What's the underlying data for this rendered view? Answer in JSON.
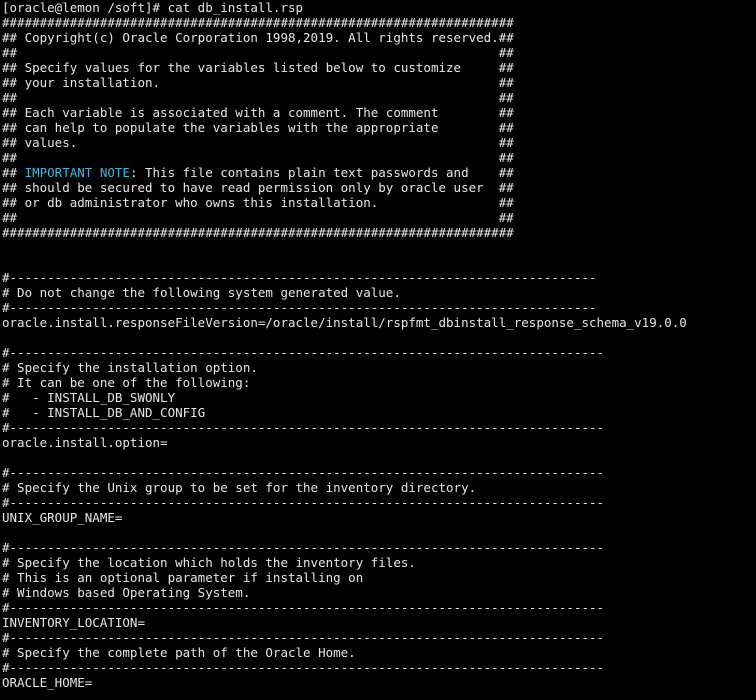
{
  "colors": {
    "background": "#000000",
    "text": "#e6e6e6",
    "highlight": "#3fb8d9"
  },
  "terminal": {
    "lines": [
      "[oracle@lemon /soft]# cat db_install.rsp",
      "####################################################################",
      "## Copyright(c) Oracle Corporation 1998,2019. All rights reserved.##",
      "##                                                                ##",
      "## Specify values for the variables listed below to customize     ##",
      "## your installation.                                             ##",
      "##                                                                ##",
      "## Each variable is associated with a comment. The comment        ##",
      "## can help to populate the variables with the appropriate        ##",
      "## values.                                                        ##",
      "##                                                                ##",
      "## IMPORTANT NOTE: This file contains plain text passwords and    ##",
      "## should be secured to have read permission only by oracle user  ##",
      "## or db administrator who owns this installation.                ##",
      "##                                                                ##",
      "####################################################################",
      "",
      "",
      "#------------------------------------------------------------------------------",
      "# Do not change the following system generated value.",
      "#------------------------------------------------------------------------------",
      "oracle.install.responseFileVersion=/oracle/install/rspfmt_dbinstall_response_schema_v19.0.0",
      "",
      "#-------------------------------------------------------------------------------",
      "# Specify the installation option.",
      "# It can be one of the following:",
      "#   - INSTALL_DB_SWONLY",
      "#   - INSTALL_DB_AND_CONFIG",
      "#-------------------------------------------------------------------------------",
      "oracle.install.option=",
      "",
      "#-------------------------------------------------------------------------------",
      "# Specify the Unix group to be set for the inventory directory.",
      "#-------------------------------------------------------------------------------",
      "UNIX_GROUP_NAME=",
      "",
      "#-------------------------------------------------------------------------------",
      "# Specify the location which holds the inventory files.",
      "# This is an optional parameter if installing on",
      "# Windows based Operating System.",
      "#-------------------------------------------------------------------------------",
      "INVENTORY_LOCATION=",
      "#-------------------------------------------------------------------------------",
      "# Specify the complete path of the Oracle Home.",
      "#-------------------------------------------------------------------------------",
      "ORACLE_HOME="
    ],
    "important_note": {
      "prefix": "## ",
      "keyword": "IMPORTANT NOTE",
      "rest": ": This file contains plain text passwords and    ##"
    }
  }
}
